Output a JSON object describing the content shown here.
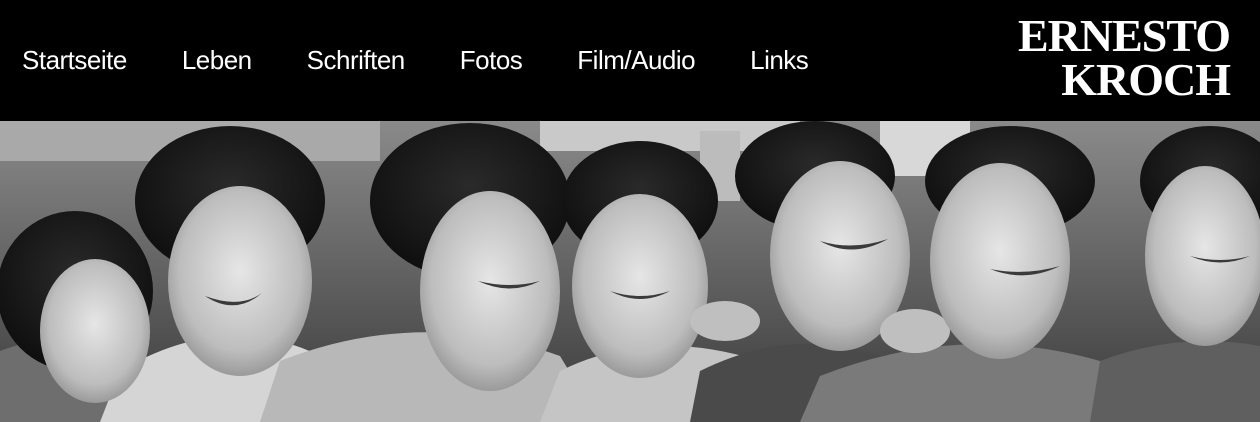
{
  "nav": {
    "items": [
      {
        "label": "Startseite"
      },
      {
        "label": "Leben"
      },
      {
        "label": "Schriften"
      },
      {
        "label": "Fotos"
      },
      {
        "label": "Film/Audio"
      },
      {
        "label": "Links"
      }
    ]
  },
  "logo": {
    "line1": "ERNESTO",
    "line2": "KROCH"
  },
  "colors": {
    "header_bg": "#000000",
    "text": "#ffffff"
  }
}
